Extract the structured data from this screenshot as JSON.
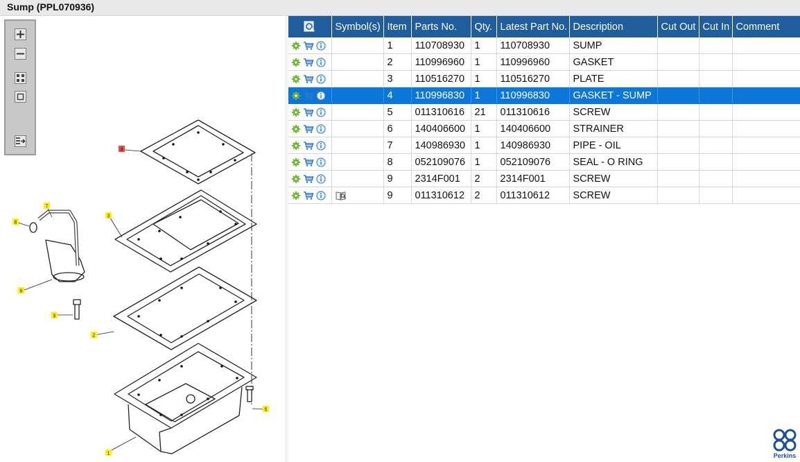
{
  "window": {
    "title": "Sump (PPL070936)"
  },
  "diagram_toolbar": {
    "icons": [
      "zoom-in-icon",
      "zoom-out-icon",
      "fit-icon",
      "actual-size-icon",
      "export-icon"
    ]
  },
  "diagram": {
    "callouts": [
      "4",
      "7",
      "8",
      "3",
      "6",
      "9",
      "2",
      "5",
      "1"
    ]
  },
  "table": {
    "headers": [
      "",
      "Symbol(s)",
      "Item",
      "Parts No.",
      "Qty.",
      "Latest Part No.",
      "Description",
      "Cut Out",
      "Cut In",
      "Comment"
    ],
    "rows": [
      {
        "symbol": "",
        "item": "1",
        "parts_no": "110708930",
        "qty": "1",
        "latest_part_no": "110708930",
        "description": "SUMP",
        "cut_out": "",
        "cut_in": "",
        "comment": ""
      },
      {
        "symbol": "",
        "item": "2",
        "parts_no": "110996960",
        "qty": "1",
        "latest_part_no": "110996960",
        "description": "GASKET",
        "cut_out": "",
        "cut_in": "",
        "comment": ""
      },
      {
        "symbol": "",
        "item": "3",
        "parts_no": "110516270",
        "qty": "1",
        "latest_part_no": "110516270",
        "description": "PLATE",
        "cut_out": "",
        "cut_in": "",
        "comment": ""
      },
      {
        "symbol": "",
        "item": "4",
        "parts_no": "110996830",
        "qty": "1",
        "latest_part_no": "110996830",
        "description": "GASKET - SUMP",
        "cut_out": "",
        "cut_in": "",
        "comment": ""
      },
      {
        "symbol": "",
        "item": "5",
        "parts_no": "011310616",
        "qty": "21",
        "latest_part_no": "011310616",
        "description": "SCREW",
        "cut_out": "",
        "cut_in": "",
        "comment": ""
      },
      {
        "symbol": "",
        "item": "6",
        "parts_no": "140406600",
        "qty": "1",
        "latest_part_no": "140406600",
        "description": "STRAINER",
        "cut_out": "",
        "cut_in": "",
        "comment": ""
      },
      {
        "symbol": "",
        "item": "7",
        "parts_no": "140986930",
        "qty": "1",
        "latest_part_no": "140986930",
        "description": "PIPE - OIL",
        "cut_out": "",
        "cut_in": "",
        "comment": ""
      },
      {
        "symbol": "",
        "item": "8",
        "parts_no": "052109076",
        "qty": "1",
        "latest_part_no": "052109076",
        "description": "SEAL - O RING",
        "cut_out": "",
        "cut_in": "",
        "comment": ""
      },
      {
        "symbol": "",
        "item": "9",
        "parts_no": "2314F001",
        "qty": "2",
        "latest_part_no": "2314F001",
        "description": "SCREW",
        "cut_out": "",
        "cut_in": "",
        "comment": ""
      },
      {
        "symbol": "book-search-icon",
        "item": "9",
        "parts_no": "011310612",
        "qty": "2",
        "latest_part_no": "011310612",
        "description": "SCREW",
        "cut_out": "",
        "cut_in": "",
        "comment": ""
      }
    ],
    "selected_item": "4",
    "row_icons": [
      "gear-icon",
      "cart-icon",
      "info-icon"
    ]
  },
  "colors": {
    "header_bg": "#1f5d9c",
    "selected_row_bg": "#0c77d9",
    "callout_fill": "#fff200",
    "callout_selected_fill": "#e84a4a",
    "gear": "#6cb52d",
    "cart": "#2f7ac8",
    "info": "#3a86d6"
  },
  "brand": {
    "logo_text": "Perkins"
  }
}
